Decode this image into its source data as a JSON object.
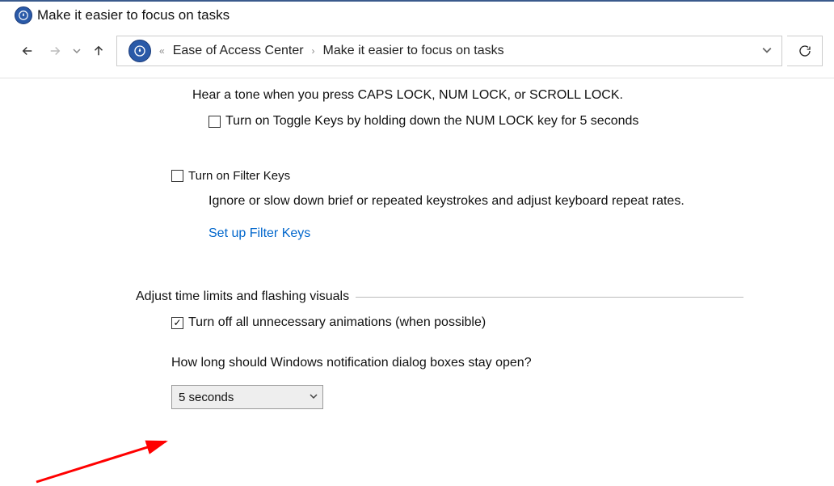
{
  "window": {
    "title": "Make it easier to focus on tasks"
  },
  "breadcrumb": {
    "item1": "Ease of Access Center",
    "item2": "Make it easier to focus on tasks"
  },
  "content": {
    "toggle_desc": "Hear a tone when you press CAPS LOCK, NUM LOCK, or SCROLL LOCK.",
    "toggle_numlock": "Turn on Toggle Keys by holding down the NUM LOCK key for 5 seconds",
    "filter_keys": "Turn on Filter Keys",
    "filter_desc": "Ignore or slow down brief or repeated keystrokes and adjust keyboard repeat rates.",
    "filter_link": "Set up Filter Keys",
    "section_heading": "Adjust time limits and flashing visuals",
    "animations_off": "Turn off all unnecessary animations (when possible)",
    "notif_question": "How long should Windows notification dialog boxes stay open?",
    "notif_value": "5 seconds"
  }
}
